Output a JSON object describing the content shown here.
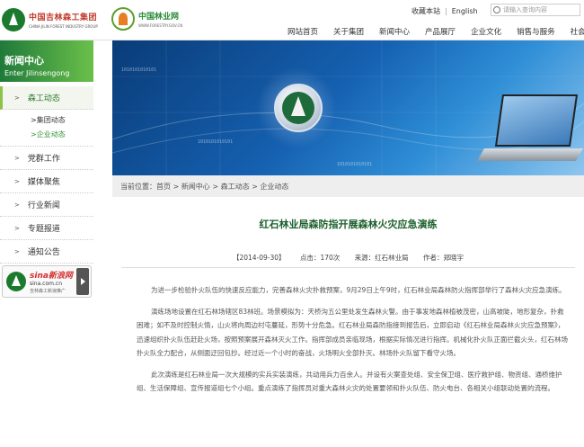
{
  "header": {
    "logo1_cn": "中国吉林森工集团",
    "logo1_en": "CHINA JILIN FOREST INDUSTRY GROUP",
    "logo2_cn": "中国林业网",
    "logo2_en": "WWW.FORESTRY.GOV.CN",
    "toplinks": [
      "收藏本站",
      "English"
    ],
    "search_placeholder": "请输入查询内容",
    "nav": [
      "网站首页",
      "关于集团",
      "新闻中心",
      "产品展厅",
      "企业文化",
      "销售与服务",
      "社会责任"
    ]
  },
  "sidebar": {
    "banner_title": "新闻中心",
    "banner_en": "Enter Jilinsengong",
    "items": [
      {
        "label": "森工动态",
        "active": true
      },
      {
        "label": "党群工作"
      },
      {
        "label": "媒体聚焦"
      },
      {
        "label": "行业新闻"
      },
      {
        "label": "专题报道"
      },
      {
        "label": "通知公告"
      }
    ],
    "subitems": [
      "集团动态",
      "企业动态"
    ],
    "sina": {
      "brand": "sina新浪网",
      "url": "sina.com.cn",
      "caption": "吉林森工新浪推广"
    }
  },
  "breadcrumb": "当前位置：首页 > 新闻中心 > 森工动态 > 企业动态",
  "article": {
    "title": "红石林业局森防指开展森林火灾应急演练",
    "date": "【2014-09-30】",
    "clicks_label": "点击：",
    "clicks": "170次",
    "source": "来源：红石林业局",
    "author": "作者：郑晓宇",
    "paragraphs": [
      "为进一步检验扑火队伍的快速反应能力，完善森林火灾扑救预案，9月29日上午9时，红石林业局森林防火指挥部举行了森林火灾应急演练。",
      "演练场地设置在红石林场辖区83林班。场景模拟为：天桥沟五公里处发生森林火警。由于事发地森林植被茂密，山高坡陡，地形复杂，扑救困难；如不及时控制火情，山火将向周边村屯蔓延，形势十分危急。红石林业局森防指接到报告后，立即启动《红石林业局森林火灾应急预案》，迅速组织扑火队伍赶赴火场，按照预案展开森林灭火工作。指挥部成员亲临现场，根据实际情况进行指挥。机械化扑火队正面拦截火头，红石林场扑火队全力配合，从侧面迂回包抄。经过近一个小时的奋战，火场明火全部扑灭。林场扑火队留下看守火场。",
      "此次演练是红石林业局一次大规模的实兵实装演练，共动用兵力百余人。并设有火案查处组、安全保卫组、医疗救护组、物资组、通桥维护组、生活保障组、宣传报道组七个小组。重点演练了指挥员对重大森林火灾的处置要领和扑火队伍、防火电台、各相关小组联动处置的流程。"
    ]
  },
  "hero_code": "1010101010101"
}
